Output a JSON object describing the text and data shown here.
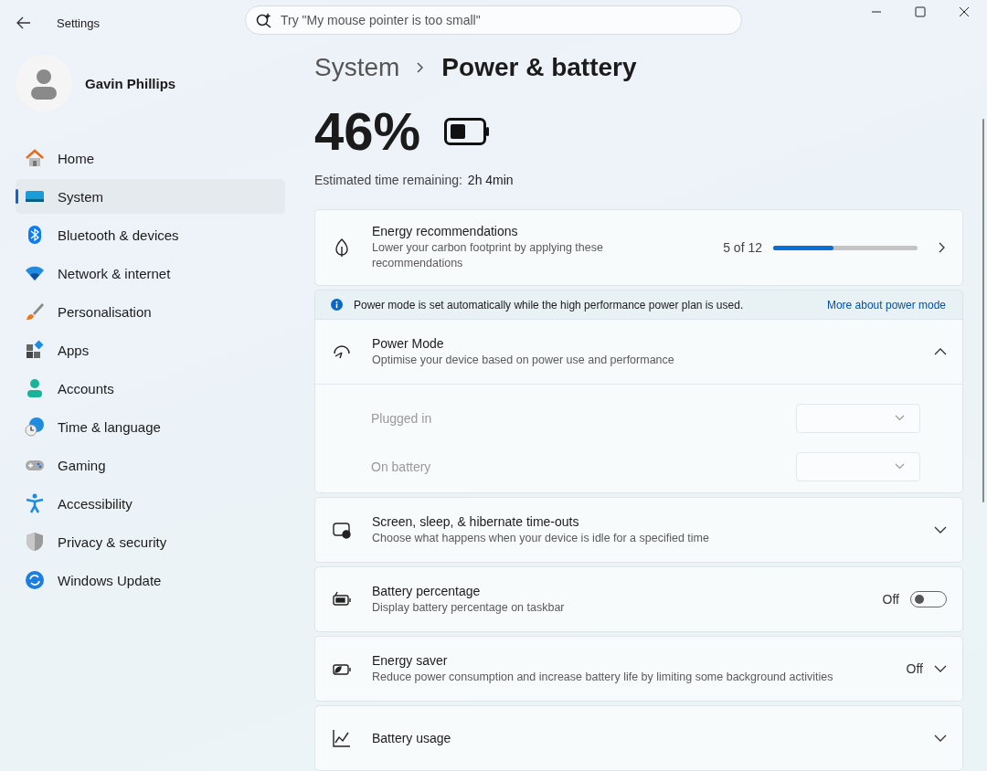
{
  "window": {
    "title": "Settings",
    "search": {
      "placeholder": "Try \"My mouse pointer is too small\""
    }
  },
  "user": {
    "name": "Gavin Phillips"
  },
  "sidebar": {
    "items": [
      {
        "label": "Home",
        "selected": false
      },
      {
        "label": "System",
        "selected": true
      },
      {
        "label": "Bluetooth & devices",
        "selected": false
      },
      {
        "label": "Network & internet",
        "selected": false
      },
      {
        "label": "Personalisation",
        "selected": false
      },
      {
        "label": "Apps",
        "selected": false
      },
      {
        "label": "Accounts",
        "selected": false
      },
      {
        "label": "Time & language",
        "selected": false
      },
      {
        "label": "Gaming",
        "selected": false
      },
      {
        "label": "Accessibility",
        "selected": false
      },
      {
        "label": "Privacy & security",
        "selected": false
      },
      {
        "label": "Windows Update",
        "selected": false
      }
    ]
  },
  "breadcrumb": {
    "parent": "System",
    "current": "Power & battery"
  },
  "battery": {
    "percent": "46%",
    "estimate_label": "Estimated time remaining:",
    "estimate_value": "2h 4min"
  },
  "cards": [
    {
      "kind": "link",
      "title": "Energy recommendations",
      "description": "Lower your carbon footprint by applying these recommendations",
      "progress_text": "5 of 12",
      "level": 0.42
    },
    {
      "kind": "expander",
      "title": "Power Mode",
      "description": "Optimise your device based on power use and performance",
      "expanded": true,
      "notice": {
        "text": "Power mode is set automatically while the high performance power plan is used.",
        "link": "More about power mode"
      },
      "options": [
        {
          "label": "Plugged in",
          "disabled": true
        },
        {
          "label": "On battery",
          "disabled": true
        }
      ]
    },
    {
      "kind": "expander",
      "title": "Screen, sleep, & hibernate time-outs",
      "description": "Choose what happens when your device is idle for a specified time",
      "expanded": false
    },
    {
      "kind": "toggle",
      "title": "Battery percentage",
      "description": "Display battery percentage on taskbar",
      "on": false,
      "state_text": "Off"
    },
    {
      "kind": "expander",
      "title": "Energy saver",
      "description": "Reduce power consumption and increase battery life by limiting some background activities",
      "status": "Off",
      "expanded": false
    },
    {
      "kind": "expander",
      "title": "Battery usage",
      "expanded": false
    }
  ]
}
